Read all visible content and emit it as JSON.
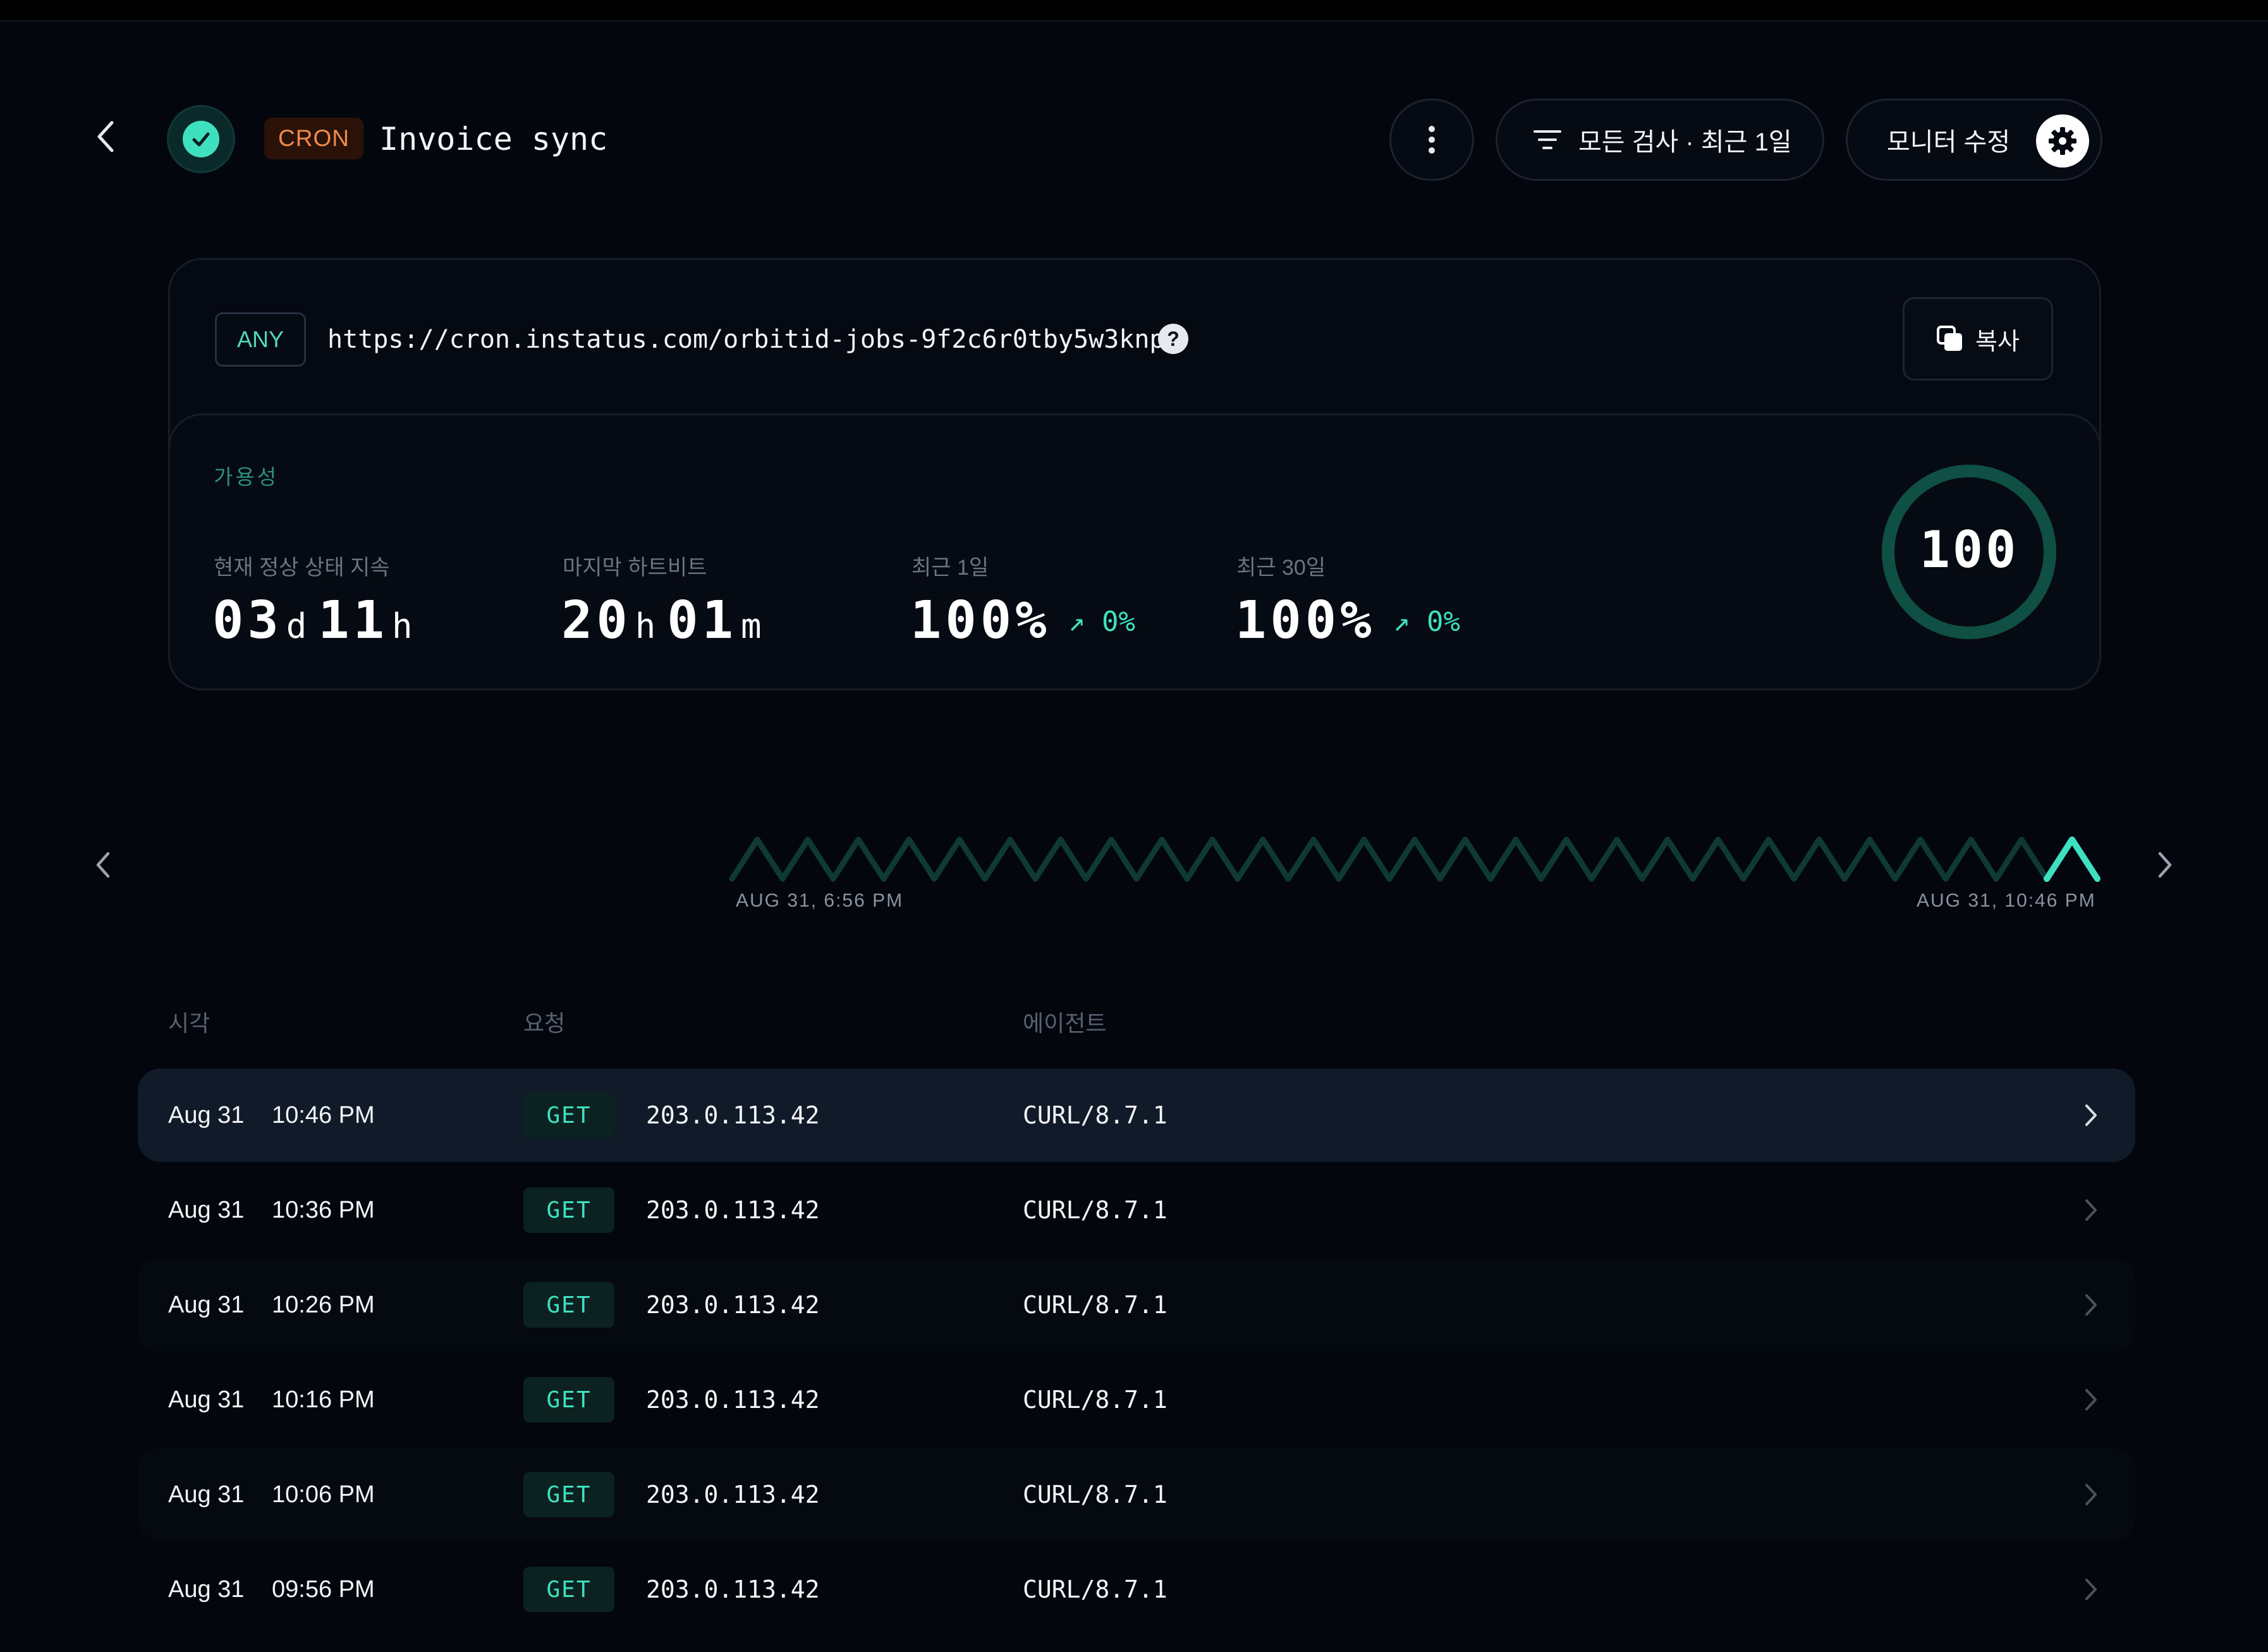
{
  "header": {
    "monitor_type": "CRON",
    "monitor_name": "Invoice sync",
    "filter_label": "모든 검사 · 최근 1일",
    "edit_label": "모니터 수정"
  },
  "endpoint": {
    "method": "ANY",
    "url": "https://cron.instatus.com/orbitid-jobs-9f2c6r0tby5w3knp",
    "copy_label": "복사"
  },
  "availability": {
    "title": "가용성",
    "stats": [
      {
        "label": "현재 정상 상태 지속",
        "parts": [
          {
            "num": "03",
            "unit": "d"
          },
          {
            "num": "11",
            "unit": "h"
          }
        ]
      },
      {
        "label": "마지막 하트비트",
        "parts": [
          {
            "num": "20",
            "unit": "h"
          },
          {
            "num": "01",
            "unit": "m"
          }
        ]
      },
      {
        "label": "최근 1일",
        "value": "100%",
        "change": "↗ 0%"
      },
      {
        "label": "최근 30일",
        "value": "100%",
        "change": "↗ 0%"
      }
    ],
    "score": "100",
    "score_fraction": 1.0
  },
  "timeline": {
    "start_label": "AUG 31, 6:56 PM",
    "end_label": "AUG 31, 10:46 PM",
    "beat_count": 27
  },
  "table": {
    "columns": {
      "time": "시각",
      "request": "요청",
      "agent": "에이전트"
    },
    "rows": [
      {
        "date": "Aug 31",
        "time": "10:46 PM",
        "method": "GET",
        "ip": "203.0.113.42",
        "agent": "CURL/8.7.1"
      },
      {
        "date": "Aug 31",
        "time": "10:36 PM",
        "method": "GET",
        "ip": "203.0.113.42",
        "agent": "CURL/8.7.1"
      },
      {
        "date": "Aug 31",
        "time": "10:26 PM",
        "method": "GET",
        "ip": "203.0.113.42",
        "agent": "CURL/8.7.1"
      },
      {
        "date": "Aug 31",
        "time": "10:16 PM",
        "method": "GET",
        "ip": "203.0.113.42",
        "agent": "CURL/8.7.1"
      },
      {
        "date": "Aug 31",
        "time": "10:06 PM",
        "method": "GET",
        "ip": "203.0.113.42",
        "agent": "CURL/8.7.1"
      },
      {
        "date": "Aug 31",
        "time": "09:56 PM",
        "method": "GET",
        "ip": "203.0.113.42",
        "agent": "CURL/8.7.1"
      }
    ]
  },
  "colors": {
    "accent": "#3fe0c0",
    "accent_dim": "#0f3a33",
    "cron_badge": "#f08a4b",
    "background": "#03060d"
  },
  "icons": [
    "back-arrow-icon",
    "check-icon",
    "more-vertical-icon",
    "filter-icon",
    "gear-icon",
    "help-icon",
    "copy-icon",
    "chevron-left-icon",
    "chevron-right-icon"
  ]
}
